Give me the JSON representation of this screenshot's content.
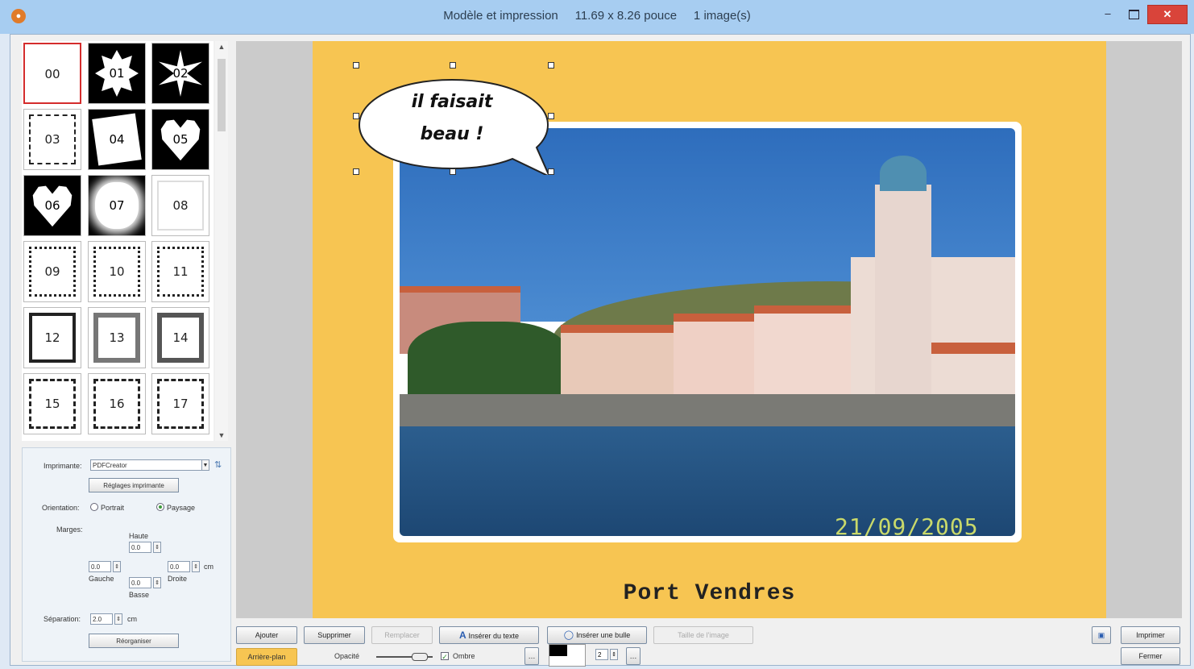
{
  "window": {
    "title": "Modèle et impression     11.69 x 8.26 pouce     1 image(s)",
    "minimize": "–",
    "close": "✕"
  },
  "thumbnails": [
    {
      "label": "00"
    },
    {
      "label": "01"
    },
    {
      "label": "02"
    },
    {
      "label": "03"
    },
    {
      "label": "04"
    },
    {
      "label": "05"
    },
    {
      "label": "06"
    },
    {
      "label": "07"
    },
    {
      "label": "08"
    },
    {
      "label": "09"
    },
    {
      "label": "10"
    },
    {
      "label": "11"
    },
    {
      "label": "12"
    },
    {
      "label": "13"
    },
    {
      "label": "14"
    },
    {
      "label": "15"
    },
    {
      "label": "16"
    },
    {
      "label": "17"
    }
  ],
  "settings": {
    "printer_label": "Imprimante:",
    "printer_value": "PDFCreator",
    "printer_settings_btn": "Réglages imprimante",
    "orientation_label": "Orientation:",
    "portrait": "Portrait",
    "landscape": "Paysage",
    "margins_label": "Marges:",
    "top_label": "Haute",
    "top_value": "0.0",
    "left_label": "Gauche",
    "left_value": "0.0",
    "right_label": "Droite",
    "right_value": "0.0",
    "bottom_label": "Basse",
    "bottom_value": "0.0",
    "unit": "cm",
    "separation_label": "Séparation:",
    "separation_value": "2.0",
    "reorganize_btn": "Réorganiser"
  },
  "preview": {
    "bubble_line1": "il faisait",
    "bubble_line2": "beau !",
    "date_stamp": "21/09/2005",
    "caption": "Port Vendres"
  },
  "toolbar": {
    "add": "Ajouter",
    "delete": "Supprimer",
    "replace": "Remplacer",
    "insert_text": "Insérer du texte",
    "insert_bubble": "Insérer une bulle",
    "image_size": "Taille de l'image",
    "background": "Arrière-plan",
    "opacity": "Opacité",
    "shadow": "Ombre",
    "shadow_value": "2",
    "print": "Imprimer",
    "close": "Fermer"
  }
}
